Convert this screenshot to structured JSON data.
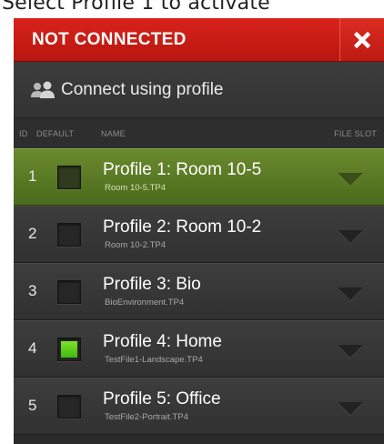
{
  "caption": "Select Profile 1 to activate",
  "status": {
    "label": "NOT CONNECTED",
    "color": "#c81d15"
  },
  "connect": {
    "label": "Connect using profile",
    "icon": "users-icon"
  },
  "columns": {
    "id": "ID",
    "default": "DEFAULT",
    "name": "NAME",
    "file_slot": "FILE SLOT"
  },
  "profiles": [
    {
      "id": "1",
      "name": "Profile 1: Room 10-5",
      "file": "Room 10-5.TP4",
      "default": false,
      "active": true
    },
    {
      "id": "2",
      "name": "Profile 2: Room 10-2",
      "file": "Room 10-2.TP4",
      "default": false,
      "active": false
    },
    {
      "id": "3",
      "name": "Profile 3: Bio",
      "file": "BioEnvironment.TP4",
      "default": false,
      "active": false
    },
    {
      "id": "4",
      "name": "Profile 4: Home",
      "file": "TestFile1-Landscape.TP4",
      "default": true,
      "active": false
    },
    {
      "id": "5",
      "name": "Profile 5: Office",
      "file": "TestFile2-Portrait.TP4",
      "default": false,
      "active": false
    }
  ],
  "colors": {
    "active_row": "#5a7a25",
    "default_checked": "#5ccc1c"
  }
}
